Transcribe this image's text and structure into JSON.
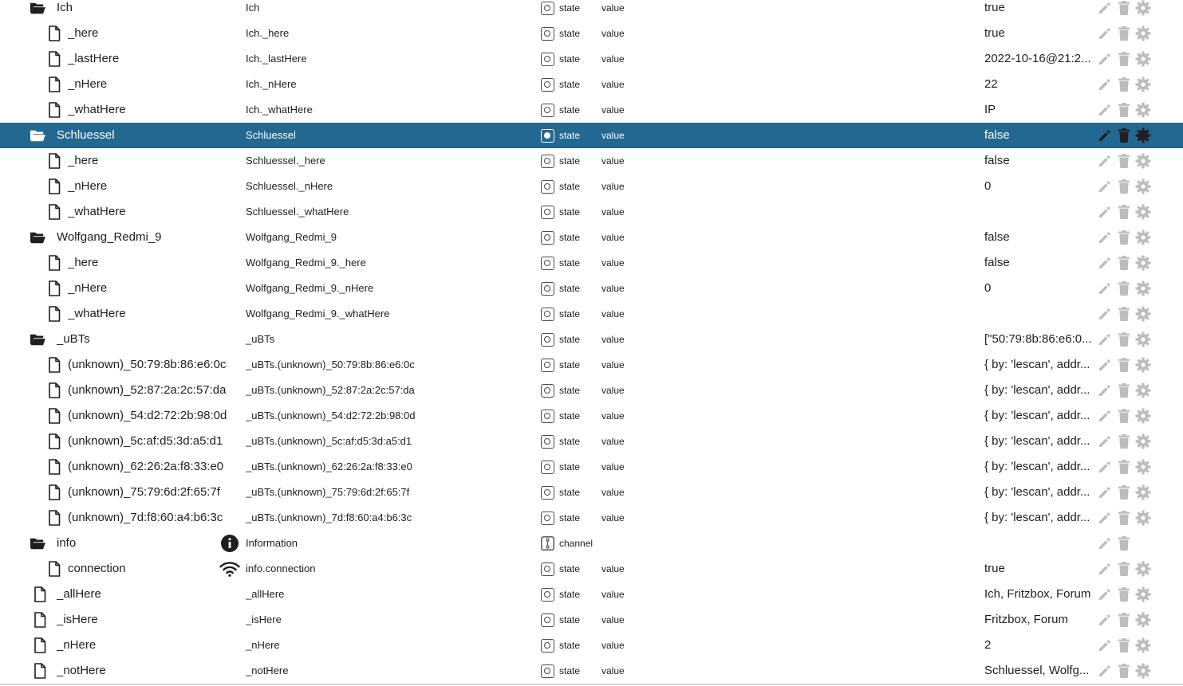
{
  "colors": {
    "selected_row_bg": "#236890",
    "selected_row_text": "#ffffff",
    "icon_gray": "#bdbdbd",
    "text": "#1e1e1e"
  },
  "tree": {
    "rows": [
      {
        "kind": "folder",
        "depth": 1,
        "name": "Ich",
        "title": "Ich",
        "type": "state",
        "role": "value",
        "value": "true",
        "actions": [
          "pencil-icon",
          "trash-icon",
          "gear-icon"
        ]
      },
      {
        "kind": "file",
        "depth": 2,
        "name": "_here",
        "title": "Ich._here",
        "type": "state",
        "role": "value",
        "value": "true",
        "actions": [
          "pencil-icon",
          "trash-icon",
          "gear-icon"
        ]
      },
      {
        "kind": "file",
        "depth": 2,
        "name": "_lastHere",
        "title": "Ich._lastHere",
        "type": "state",
        "role": "value",
        "value": "2022-10-16@21:2...",
        "actions": [
          "pencil-icon",
          "trash-icon",
          "gear-icon"
        ]
      },
      {
        "kind": "file",
        "depth": 2,
        "name": "_nHere",
        "title": "Ich._nHere",
        "type": "state",
        "role": "value",
        "value": "22",
        "actions": [
          "pencil-icon",
          "trash-icon",
          "gear-icon"
        ]
      },
      {
        "kind": "file",
        "depth": 2,
        "name": "_whatHere",
        "title": "Ich._whatHere",
        "type": "state",
        "role": "value",
        "value": "IP",
        "actions": [
          "pencil-icon",
          "trash-icon",
          "gear-icon"
        ]
      },
      {
        "kind": "folder",
        "depth": 1,
        "name": "Schluessel",
        "title": "Schluessel",
        "type": "state",
        "role": "value",
        "value": "false",
        "selected": true,
        "actions": [
          "pencil-icon",
          "trash-icon",
          "gear-icon"
        ]
      },
      {
        "kind": "file",
        "depth": 2,
        "name": "_here",
        "title": "Schluessel._here",
        "type": "state",
        "role": "value",
        "value": "false",
        "actions": [
          "pencil-icon",
          "trash-icon",
          "gear-icon"
        ]
      },
      {
        "kind": "file",
        "depth": 2,
        "name": "_nHere",
        "title": "Schluessel._nHere",
        "type": "state",
        "role": "value",
        "value": "0",
        "actions": [
          "pencil-icon",
          "trash-icon",
          "gear-icon"
        ]
      },
      {
        "kind": "file",
        "depth": 2,
        "name": "_whatHere",
        "title": "Schluessel._whatHere",
        "type": "state",
        "role": "value",
        "value": "",
        "actions": [
          "pencil-icon",
          "trash-icon",
          "gear-icon"
        ]
      },
      {
        "kind": "folder",
        "depth": 1,
        "name": "Wolfgang_Redmi_9",
        "title": "Wolfgang_Redmi_9",
        "type": "state",
        "role": "value",
        "value": "false",
        "actions": [
          "pencil-icon",
          "trash-icon",
          "gear-icon"
        ]
      },
      {
        "kind": "file",
        "depth": 2,
        "name": "_here",
        "title": "Wolfgang_Redmi_9._here",
        "type": "state",
        "role": "value",
        "value": "false",
        "actions": [
          "pencil-icon",
          "trash-icon",
          "gear-icon"
        ]
      },
      {
        "kind": "file",
        "depth": 2,
        "name": "_nHere",
        "title": "Wolfgang_Redmi_9._nHere",
        "type": "state",
        "role": "value",
        "value": "0",
        "actions": [
          "pencil-icon",
          "trash-icon",
          "gear-icon"
        ]
      },
      {
        "kind": "file",
        "depth": 2,
        "name": "_whatHere",
        "title": "Wolfgang_Redmi_9._whatHere",
        "type": "state",
        "role": "value",
        "value": "",
        "actions": [
          "pencil-icon",
          "trash-icon",
          "gear-icon"
        ]
      },
      {
        "kind": "folder",
        "depth": 1,
        "name": "_uBTs",
        "title": "_uBTs",
        "type": "state",
        "role": "value",
        "value": "[\"50:79:8b:86:e6:0...",
        "actions": [
          "pencil-icon",
          "trash-icon",
          "gear-icon"
        ]
      },
      {
        "kind": "file",
        "depth": 2,
        "name": "(unknown)_50:79:8b:86:e6:0c",
        "title": "_uBTs.(unknown)_50:79:8b:86:e6:0c",
        "type": "state",
        "role": "value",
        "value": "{ by: 'lescan', addr...",
        "actions": [
          "pencil-icon",
          "trash-icon",
          "gear-icon"
        ]
      },
      {
        "kind": "file",
        "depth": 2,
        "name": "(unknown)_52:87:2a:2c:57:da",
        "title": "_uBTs.(unknown)_52:87:2a:2c:57:da",
        "type": "state",
        "role": "value",
        "value": "{ by: 'lescan', addr...",
        "actions": [
          "pencil-icon",
          "trash-icon",
          "gear-icon"
        ]
      },
      {
        "kind": "file",
        "depth": 2,
        "name": "(unknown)_54:d2:72:2b:98:0d",
        "title": "_uBTs.(unknown)_54:d2:72:2b:98:0d",
        "type": "state",
        "role": "value",
        "value": "{ by: 'lescan', addr...",
        "actions": [
          "pencil-icon",
          "trash-icon",
          "gear-icon"
        ]
      },
      {
        "kind": "file",
        "depth": 2,
        "name": "(unknown)_5c:af:d5:3d:a5:d1",
        "title": "_uBTs.(unknown)_5c:af:d5:3d:a5:d1",
        "type": "state",
        "role": "value",
        "value": "{ by: 'lescan', addr...",
        "actions": [
          "pencil-icon",
          "trash-icon",
          "gear-icon"
        ]
      },
      {
        "kind": "file",
        "depth": 2,
        "name": "(unknown)_62:26:2a:f8:33:e0",
        "title": "_uBTs.(unknown)_62:26:2a:f8:33:e0",
        "type": "state",
        "role": "value",
        "value": "{ by: 'lescan', addr...",
        "actions": [
          "pencil-icon",
          "trash-icon",
          "gear-icon"
        ]
      },
      {
        "kind": "file",
        "depth": 2,
        "name": "(unknown)_75:79:6d:2f:65:7f",
        "title": "_uBTs.(unknown)_75:79:6d:2f:65:7f",
        "type": "state",
        "role": "value",
        "value": "{ by: 'lescan', addr...",
        "actions": [
          "pencil-icon",
          "trash-icon",
          "gear-icon"
        ]
      },
      {
        "kind": "file",
        "depth": 2,
        "name": "(unknown)_7d:f8:60:a4:b6:3c",
        "title": "_uBTs.(unknown)_7d:f8:60:a4:b6:3c",
        "type": "state",
        "role": "value",
        "value": "{ by: 'lescan', addr...",
        "actions": [
          "pencil-icon",
          "trash-icon",
          "gear-icon"
        ]
      },
      {
        "kind": "folder",
        "depth": 1,
        "name": "info",
        "title": "Information",
        "title_icon": "info-icon",
        "type": "channel",
        "role": "",
        "value": "",
        "actions": [
          "pencil-icon",
          "trash-icon"
        ]
      },
      {
        "kind": "file",
        "depth": 2,
        "name": "connection",
        "title": "info.connection",
        "title_icon": "wifi-icon",
        "type": "state",
        "role": "value",
        "value": "true",
        "actions": [
          "pencil-icon",
          "trash-icon",
          "gear-icon"
        ]
      },
      {
        "kind": "file",
        "depth": 1,
        "name": "_allHere",
        "title": "_allHere",
        "type": "state",
        "role": "value",
        "value": "Ich, Fritzbox, Forum",
        "actions": [
          "pencil-icon",
          "trash-icon",
          "gear-icon"
        ]
      },
      {
        "kind": "file",
        "depth": 1,
        "name": "_isHere",
        "title": "_isHere",
        "type": "state",
        "role": "value",
        "value": "Fritzbox, Forum",
        "actions": [
          "pencil-icon",
          "trash-icon",
          "gear-icon"
        ]
      },
      {
        "kind": "file",
        "depth": 1,
        "name": "_nHere",
        "title": "_nHere",
        "type": "state",
        "role": "value",
        "value": "2",
        "actions": [
          "pencil-icon",
          "trash-icon",
          "gear-icon"
        ]
      },
      {
        "kind": "file",
        "depth": 1,
        "name": "_notHere",
        "title": "_notHere",
        "type": "state",
        "role": "value",
        "value": "Schluessel, Wolfg...",
        "actions": [
          "pencil-icon",
          "trash-icon",
          "gear-icon"
        ]
      }
    ]
  }
}
